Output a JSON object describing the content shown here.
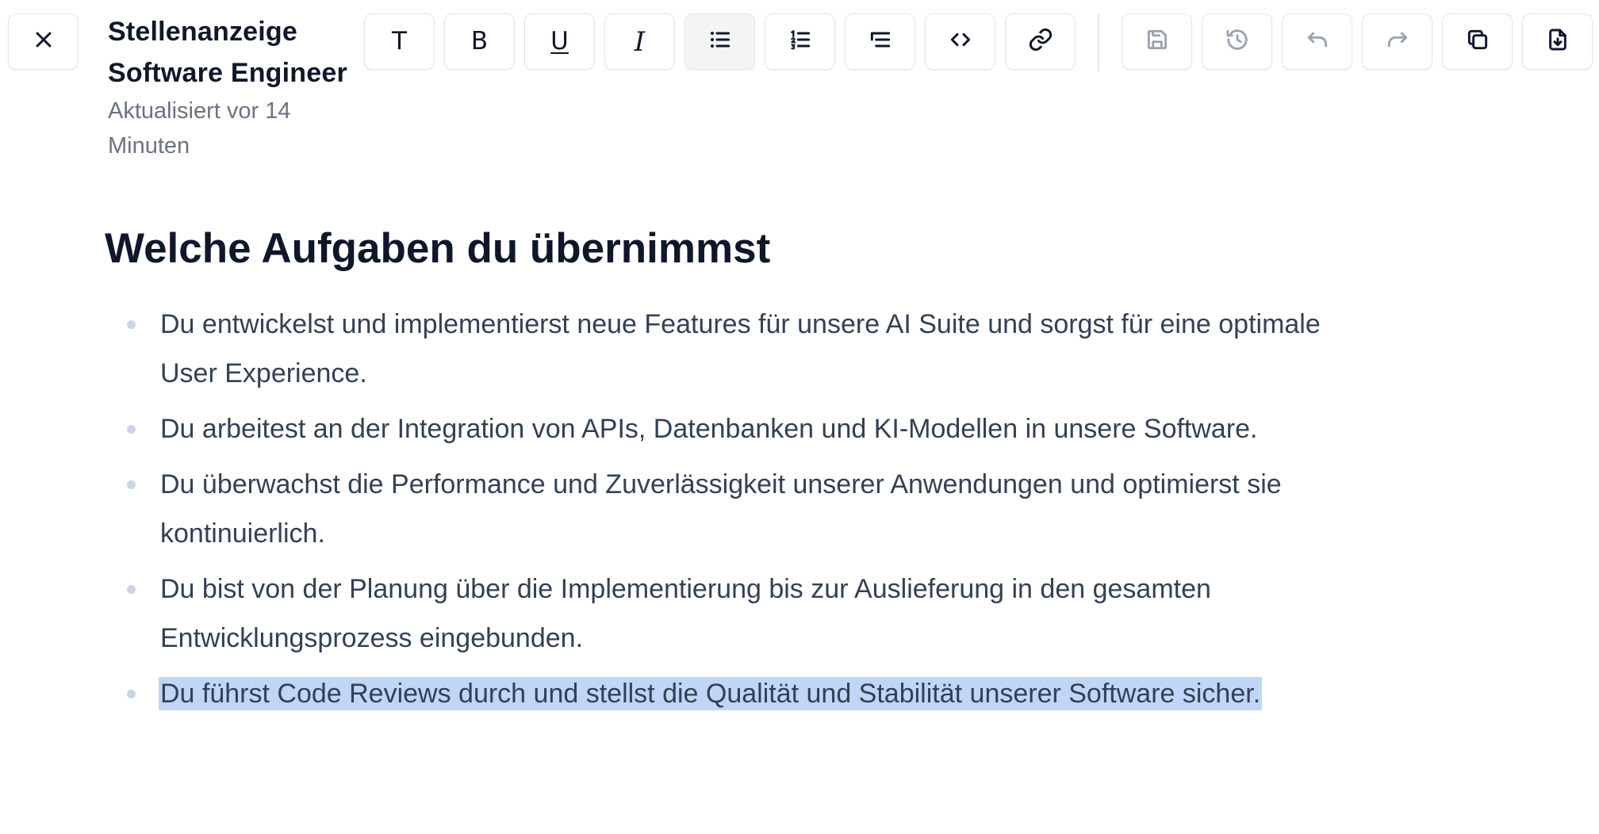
{
  "header": {
    "title": "Stellenanzeige Software Engineer",
    "subtitle": "Aktualisiert vor 14 Minuten"
  },
  "toolbar": {
    "close": {
      "icon": "close-icon"
    },
    "text": {
      "icon": "text-icon",
      "glyph": "T"
    },
    "bold": {
      "icon": "bold-icon",
      "glyph": "B"
    },
    "underline": {
      "icon": "underline-icon",
      "glyph": "U"
    },
    "italic": {
      "icon": "italic-icon",
      "glyph": "I"
    },
    "bullet_list": {
      "icon": "bullet-list-icon",
      "active": true
    },
    "numbered_list": {
      "icon": "numbered-list-icon"
    },
    "indent_list": {
      "icon": "indent-list-icon"
    },
    "code": {
      "icon": "code-icon"
    },
    "link": {
      "icon": "link-icon"
    },
    "save": {
      "icon": "save-icon",
      "enabled": false
    },
    "history": {
      "icon": "history-icon",
      "enabled": false
    },
    "undo": {
      "icon": "undo-icon",
      "enabled": false
    },
    "redo": {
      "icon": "redo-icon",
      "enabled": false
    },
    "copy": {
      "icon": "copy-icon"
    },
    "download": {
      "icon": "download-icon"
    }
  },
  "content": {
    "heading": "Welche Aufgaben du übernimmst",
    "items": [
      {
        "text": "Du entwickelst und implementierst neue Features für unsere AI Suite und sorgst für eine optimale User Experience."
      },
      {
        "text": "Du arbeitest an der Integration von APIs, Datenbanken und KI-Modellen in unsere Software."
      },
      {
        "text": "Du überwachst die Performance und Zuverlässigkeit unserer Anwendungen und optimierst sie kontinuierlich."
      },
      {
        "text": "Du bist von der Planung über die Implementierung bis zur Auslieferung in den gesamten Entwicklungsprozess eingebunden."
      },
      {
        "text": "Du führst Code Reviews durch und stellst die Qualität und Stabilität unserer Software sicher.",
        "selected": true
      }
    ]
  },
  "colors": {
    "text": "#0f172a",
    "body_text": "#334155",
    "muted": "#6b7280",
    "selection": "#bfd6f6",
    "border": "#e2e5ea"
  }
}
